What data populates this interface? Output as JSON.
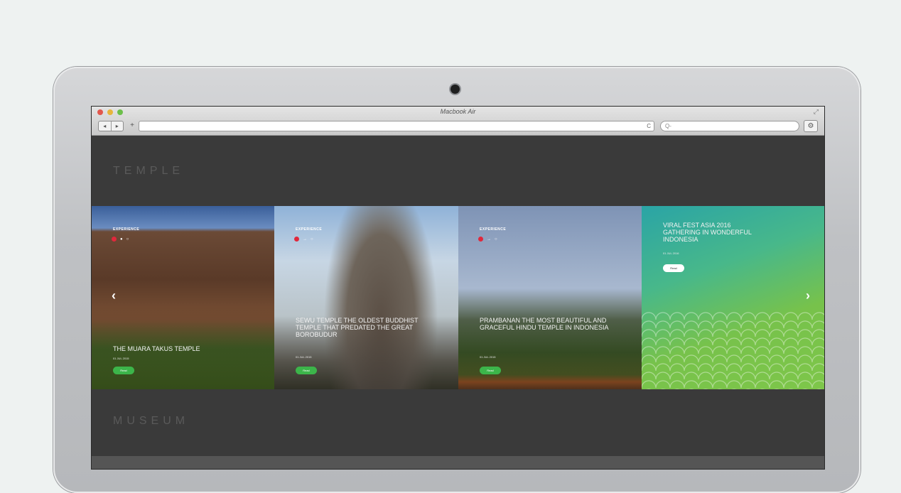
{
  "browser": {
    "window_title": "Macbook Air",
    "nav_back": "◂",
    "nav_forward": "▸",
    "add_tab": "+",
    "reload": "C",
    "search_placeholder": "Q-",
    "settings": "⚙"
  },
  "page": {
    "section_temple": "TEMPLE",
    "section_museum": "MUSEUM"
  },
  "carousel": {
    "prev": "‹",
    "next": "›",
    "cards": [
      {
        "tag": "EXPERIENCE",
        "title": "THE MUARA TAKUS TEMPLE",
        "date": "01 JUL 2015",
        "button": "Read"
      },
      {
        "tag": "EXPERIENCE",
        "title": "SEWU TEMPLE THE OLDEST BUDDHIST TEMPLE THAT PREDATED THE GREAT BOROBUDUR",
        "date": "01 JUL 2015",
        "button": "Read"
      },
      {
        "tag": "EXPERIENCE",
        "title": "PRAMBANAN THE MOST BEAUTIFUL AND GRACEFUL HINDU TEMPLE IN INDONESIA",
        "date": "01 JUL 2015",
        "button": "Read"
      },
      {
        "tag": "",
        "title": "VIRAL FEST ASIA 2016 GATHERING IN WONDERFUL INDONESIA",
        "date": "01 JUL 2016",
        "button": "Read"
      }
    ]
  }
}
